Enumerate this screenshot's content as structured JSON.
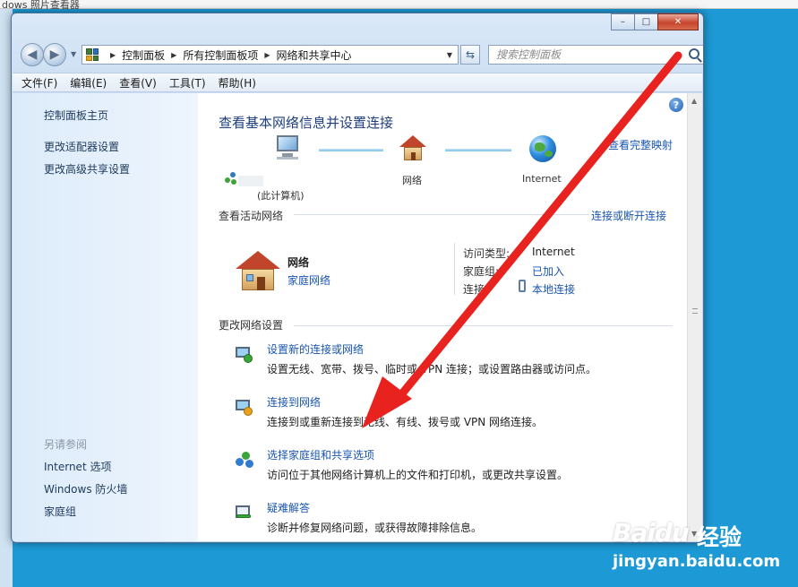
{
  "background_window": {
    "title": "dows 照片查看器"
  },
  "window": {
    "controls": {
      "minimize": "–",
      "maximize": "□",
      "close": "✕"
    }
  },
  "address_bar": {
    "breadcrumbs": [
      "控制面板",
      "所有控制面板项",
      "网络和共享中心"
    ],
    "search_placeholder": "搜索控制面板"
  },
  "menu": [
    "文件(F)",
    "编辑(E)",
    "查看(V)",
    "工具(T)",
    "帮助(H)"
  ],
  "sidebar": {
    "home": "控制面板主页",
    "links": [
      "更改适配器设置",
      "更改高级共享设置"
    ],
    "see_also_heading": "另请参阅",
    "see_also": [
      "Internet 选项",
      "Windows 防火墙",
      "家庭组"
    ]
  },
  "content": {
    "title": "查看基本网络信息并设置连接",
    "map_link": "查看完整映射",
    "map": {
      "computer_label": "(此计算机)",
      "network_label": "网络",
      "internet_label": "Internet"
    },
    "active_networks": {
      "heading": "查看活动网络",
      "link": "连接或断开连接",
      "network_name": "网络",
      "network_type": "家庭网络",
      "props": [
        {
          "label": "访问类型:",
          "value": "Internet",
          "is_link": false
        },
        {
          "label": "家庭组:",
          "value": "已加入",
          "is_link": true
        },
        {
          "label": "连接:",
          "value": "本地连接",
          "is_link": true
        }
      ]
    },
    "change_settings": {
      "heading": "更改网络设置",
      "tasks": [
        {
          "title": "设置新的连接或网络",
          "desc": "设置无线、宽带、拨号、临时或 VPN 连接；或设置路由器或访问点。"
        },
        {
          "title": "连接到网络",
          "desc": "连接到或重新连接到无线、有线、拨号或 VPN 网络连接。"
        },
        {
          "title": "选择家庭组和共享选项",
          "desc": "访问位于其他网络计算机上的文件和打印机，或更改共享设置。"
        },
        {
          "title": "疑难解答",
          "desc": "诊断并修复网络问题，或获得故障排除信息。"
        }
      ]
    }
  },
  "annotation": {
    "arrow_color": "#e8221e"
  },
  "watermark": {
    "logo": "Baidu",
    "cn": "经验",
    "url": "jingyan.baidu.com"
  },
  "icons": [
    "back-arrow-icon",
    "forward-arrow-icon",
    "control-panel-icon",
    "refresh-icon",
    "search-icon",
    "help-icon",
    "computer-icon",
    "house-icon",
    "globe-icon",
    "plug-icon",
    "new-connection-icon",
    "connect-network-icon",
    "homegroup-icon",
    "troubleshoot-icon"
  ]
}
